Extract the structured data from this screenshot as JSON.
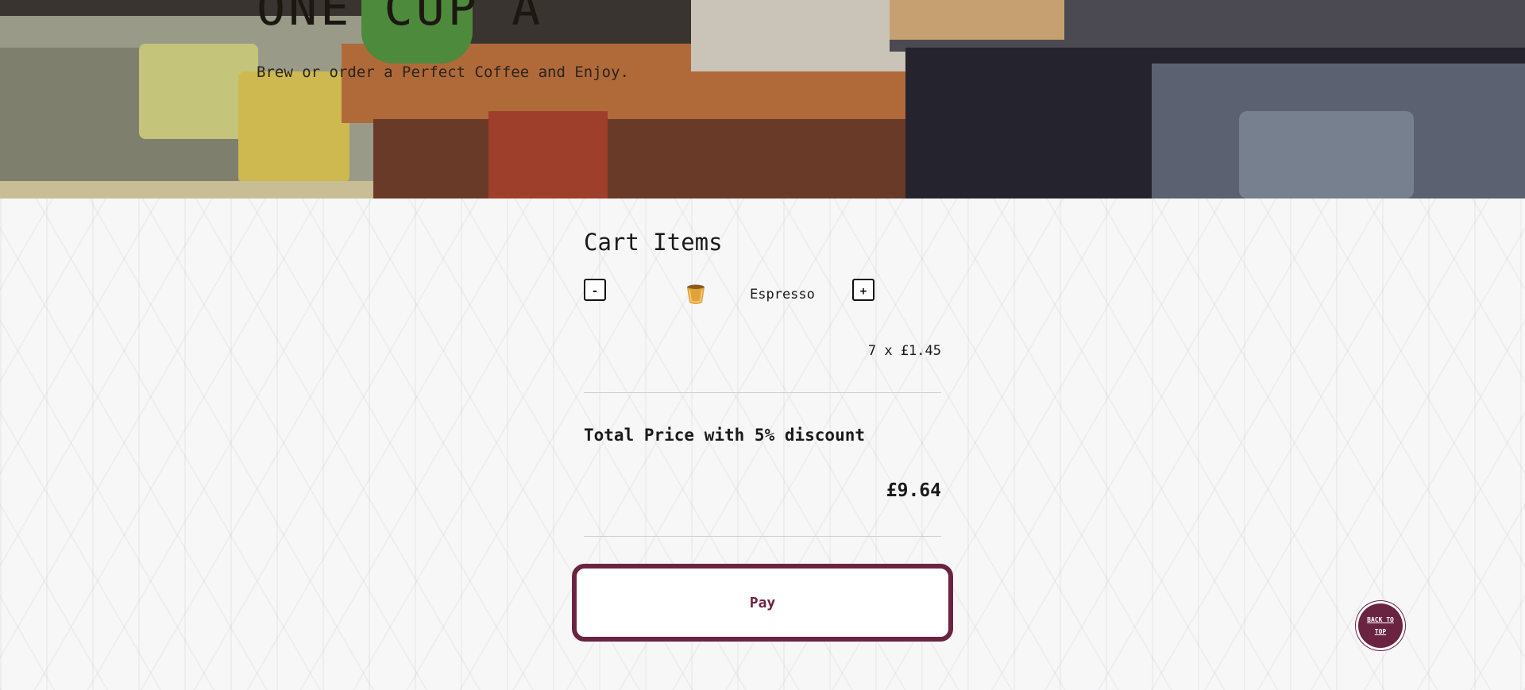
{
  "hero": {
    "title": "ONE CUP A",
    "subtitle": "Brew or order a Perfect Coffee and Enjoy."
  },
  "cart": {
    "title": "Cart Items",
    "decrement_label": "-",
    "increment_label": "+",
    "items": [
      {
        "name": "Espresso",
        "icon": "espresso-cup-icon",
        "quantity_price": "7 x £1.45"
      }
    ],
    "total_label": "Total Price with 5% discount",
    "total_value": "£9.64",
    "pay_label": "Pay"
  },
  "back_to_top": {
    "label": "BACK TO TOP"
  },
  "colors": {
    "accent": "#6b2342"
  }
}
